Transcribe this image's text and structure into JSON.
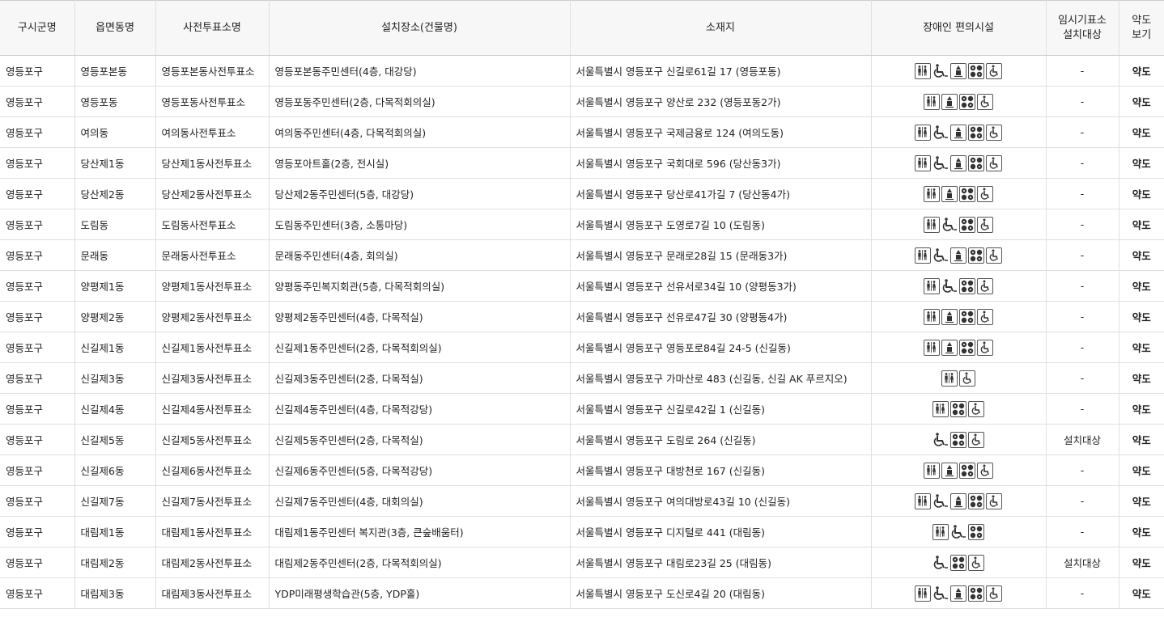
{
  "headers": [
    "구시군명",
    "읍면동명",
    "사전투표소명",
    "설치장소(건물명)",
    "소재지",
    "장애인 편의시설",
    "임시기표소\n설치대상",
    "약도\n보기"
  ],
  "rows": [
    {
      "gu": "영등포구",
      "dong": "영등포본동",
      "station": "영등포본동사전투표소",
      "place": "영등포본동주민센터(4층, 대강당)",
      "addr": "서울특별시 영등포구 신길로61길 17 (영등포동)",
      "icons": [
        "toilet-icon",
        "wheelchair-icon",
        "elevator-icon",
        "braille-block-icon",
        "ramp-icon"
      ],
      "temp": "-",
      "map": "약도"
    },
    {
      "gu": "영등포구",
      "dong": "영등포동",
      "station": "영등포동사전투표소",
      "place": "영등포동주민센터(2층, 다목적회의실)",
      "addr": "서울특별시 영등포구 양산로 232 (영등포동2가)",
      "icons": [
        "toilet-icon",
        "elevator-icon",
        "braille-block-icon",
        "ramp-icon"
      ],
      "temp": "-",
      "map": "약도"
    },
    {
      "gu": "영등포구",
      "dong": "여의동",
      "station": "여의동사전투표소",
      "place": "여의동주민센터(4층, 다목적회의실)",
      "addr": "서울특별시 영등포구 국제금융로 124 (여의도동)",
      "icons": [
        "toilet-icon",
        "wheelchair-icon",
        "elevator-icon",
        "braille-block-icon",
        "ramp-icon"
      ],
      "temp": "-",
      "map": "약도"
    },
    {
      "gu": "영등포구",
      "dong": "당산제1동",
      "station": "당산제1동사전투표소",
      "place": "영등포아트홀(2층, 전시실)",
      "addr": "서울특별시 영등포구 국회대로 596 (당산동3가)",
      "icons": [
        "toilet-icon",
        "wheelchair-icon",
        "elevator-icon",
        "braille-block-icon",
        "ramp-icon"
      ],
      "temp": "-",
      "map": "약도"
    },
    {
      "gu": "영등포구",
      "dong": "당산제2동",
      "station": "당산제2동사전투표소",
      "place": "당산제2동주민센터(5층, 대강당)",
      "addr": "서울특별시 영등포구 당산로41가길 7 (당산동4가)",
      "icons": [
        "toilet-icon",
        "elevator-icon",
        "braille-block-icon",
        "ramp-icon"
      ],
      "temp": "-",
      "map": "약도"
    },
    {
      "gu": "영등포구",
      "dong": "도림동",
      "station": "도림동사전투표소",
      "place": "도림동주민센터(3층, 소통마당)",
      "addr": "서울특별시 영등포구 도영로7길 10 (도림동)",
      "icons": [
        "toilet-icon",
        "wheelchair-icon",
        "braille-block-icon",
        "ramp-icon"
      ],
      "temp": "-",
      "map": "약도"
    },
    {
      "gu": "영등포구",
      "dong": "문래동",
      "station": "문래동사전투표소",
      "place": "문래동주민센터(4층, 회의실)",
      "addr": "서울특별시 영등포구 문래로28길 15 (문래동3가)",
      "icons": [
        "toilet-icon",
        "wheelchair-icon",
        "elevator-icon",
        "braille-block-icon",
        "ramp-icon"
      ],
      "temp": "-",
      "map": "약도"
    },
    {
      "gu": "영등포구",
      "dong": "양평제1동",
      "station": "양평제1동사전투표소",
      "place": "양평동주민복지회관(5층, 다목적회의실)",
      "addr": "서울특별시 영등포구 선유서로34길 10 (양평동3가)",
      "icons": [
        "toilet-icon",
        "wheelchair-icon",
        "braille-block-icon",
        "ramp-icon"
      ],
      "temp": "-",
      "map": "약도"
    },
    {
      "gu": "영등포구",
      "dong": "양평제2동",
      "station": "양평제2동사전투표소",
      "place": "양평제2동주민센터(4층, 다목적실)",
      "addr": "서울특별시 영등포구 선유로47길 30 (양평동4가)",
      "icons": [
        "toilet-icon",
        "elevator-icon",
        "braille-block-icon",
        "ramp-icon"
      ],
      "temp": "-",
      "map": "약도"
    },
    {
      "gu": "영등포구",
      "dong": "신길제1동",
      "station": "신길제1동사전투표소",
      "place": "신길제1동주민센터(2층, 다목적회의실)",
      "addr": "서울특별시 영등포구 영등포로84길 24-5 (신길동)",
      "icons": [
        "toilet-icon",
        "elevator-icon",
        "braille-block-icon",
        "ramp-icon"
      ],
      "temp": "-",
      "map": "약도"
    },
    {
      "gu": "영등포구",
      "dong": "신길제3동",
      "station": "신길제3동사전투표소",
      "place": "신길제3동주민센터(2층, 다목적실)",
      "addr": "서울특별시 영등포구 가마산로 483 (신길동, 신길 AK 푸르지오)",
      "icons": [
        "toilet-icon",
        "ramp-icon"
      ],
      "temp": "-",
      "map": "약도"
    },
    {
      "gu": "영등포구",
      "dong": "신길제4동",
      "station": "신길제4동사전투표소",
      "place": "신길제4동주민센터(4층, 다목적강당)",
      "addr": "서울특별시 영등포구 신길로42길 1 (신길동)",
      "icons": [
        "toilet-icon",
        "braille-block-icon",
        "ramp-icon"
      ],
      "temp": "-",
      "map": "약도"
    },
    {
      "gu": "영등포구",
      "dong": "신길제5동",
      "station": "신길제5동사전투표소",
      "place": "신길제5동주민센터(2층, 다목적실)",
      "addr": "서울특별시 영등포구 도림로 264 (신길동)",
      "icons": [
        "wheelchair-icon",
        "braille-block-icon",
        "ramp-icon"
      ],
      "temp": "설치대상",
      "map": "약도"
    },
    {
      "gu": "영등포구",
      "dong": "신길제6동",
      "station": "신길제6동사전투표소",
      "place": "신길제6동주민센터(5층, 다목적강당)",
      "addr": "서울특별시 영등포구 대방천로 167 (신길동)",
      "icons": [
        "toilet-icon",
        "elevator-icon",
        "braille-block-icon",
        "ramp-icon"
      ],
      "temp": "-",
      "map": "약도"
    },
    {
      "gu": "영등포구",
      "dong": "신길제7동",
      "station": "신길제7동사전투표소",
      "place": "신길제7동주민센터(4층, 대회의실)",
      "addr": "서울특별시 영등포구 여의대방로43길 10 (신길동)",
      "icons": [
        "toilet-icon",
        "wheelchair-icon",
        "elevator-icon",
        "braille-block-icon",
        "ramp-icon"
      ],
      "temp": "-",
      "map": "약도"
    },
    {
      "gu": "영등포구",
      "dong": "대림제1동",
      "station": "대림제1동사전투표소",
      "place": "대림제1동주민센터 복지관(3층, 큰숲배움터)",
      "addr": "서울특별시 영등포구 디지털로 441 (대림동)",
      "icons": [
        "toilet-icon",
        "wheelchair-icon",
        "braille-block-icon"
      ],
      "temp": "-",
      "map": "약도"
    },
    {
      "gu": "영등포구",
      "dong": "대림제2동",
      "station": "대림제2동사전투표소",
      "place": "대림제2동주민센터(2층, 다목적회의실)",
      "addr": "서울특별시 영등포구 대림로23길 25 (대림동)",
      "icons": [
        "wheelchair-icon",
        "braille-block-icon",
        "ramp-icon"
      ],
      "temp": "설치대상",
      "map": "약도"
    },
    {
      "gu": "영등포구",
      "dong": "대림제3동",
      "station": "대림제3동사전투표소",
      "place": "YDP미래평생학습관(5층, YDP홀)",
      "addr": "서울특별시 영등포구 도신로4길 20 (대림동)",
      "icons": [
        "toilet-icon",
        "wheelchair-icon",
        "elevator-icon",
        "braille-block-icon",
        "ramp-icon"
      ],
      "temp": "-",
      "map": "약도"
    }
  ]
}
